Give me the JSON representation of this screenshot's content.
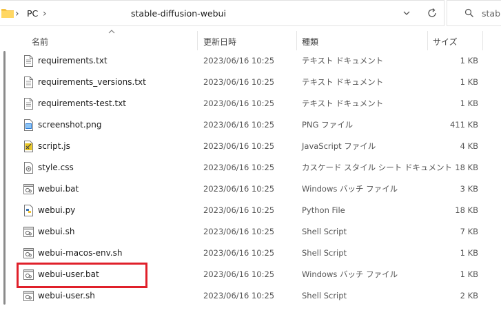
{
  "address_bar": {
    "crumbs": [
      "PC",
      "stable-diffusion-webui"
    ]
  },
  "search": {
    "text": "stable"
  },
  "columns": {
    "name": "名前",
    "date": "更新日時",
    "type": "種類",
    "size": "サイズ"
  },
  "files": [
    {
      "name": "requirements.txt",
      "date": "2023/06/16 10:25",
      "type": "テキスト ドキュメント",
      "size": "1 KB",
      "icon": "text-file-icon"
    },
    {
      "name": "requirements_versions.txt",
      "date": "2023/06/16 10:25",
      "type": "テキスト ドキュメント",
      "size": "1 KB",
      "icon": "text-file-icon"
    },
    {
      "name": "requirements-test.txt",
      "date": "2023/06/16 10:25",
      "type": "テキスト ドキュメント",
      "size": "1 KB",
      "icon": "text-file-icon"
    },
    {
      "name": "screenshot.png",
      "date": "2023/06/16 10:25",
      "type": "PNG ファイル",
      "size": "411 KB",
      "icon": "image-file-icon"
    },
    {
      "name": "script.js",
      "date": "2023/06/16 10:25",
      "type": "JavaScript ファイル",
      "size": "4 KB",
      "icon": "script-file-icon"
    },
    {
      "name": "style.css",
      "date": "2023/06/16 10:25",
      "type": "カスケード スタイル シート ドキュメント",
      "size": "18 KB",
      "icon": "css-file-icon"
    },
    {
      "name": "webui.bat",
      "date": "2023/06/16 10:25",
      "type": "Windows バッチ ファイル",
      "size": "3 KB",
      "icon": "batch-file-icon"
    },
    {
      "name": "webui.py",
      "date": "2023/06/16 10:25",
      "type": "Python File",
      "size": "18 KB",
      "icon": "python-file-icon"
    },
    {
      "name": "webui.sh",
      "date": "2023/06/16 10:25",
      "type": "Shell Script",
      "size": "7 KB",
      "icon": "shell-file-icon"
    },
    {
      "name": "webui-macos-env.sh",
      "date": "2023/06/16 10:25",
      "type": "Shell Script",
      "size": "1 KB",
      "icon": "shell-file-icon"
    },
    {
      "name": "webui-user.bat",
      "date": "2023/06/16 10:25",
      "type": "Windows バッチ ファイル",
      "size": "1 KB",
      "icon": "batch-file-icon"
    },
    {
      "name": "webui-user.sh",
      "date": "2023/06/16 10:25",
      "type": "Shell Script",
      "size": "2 KB",
      "icon": "shell-file-icon"
    }
  ],
  "colors": {
    "highlight": "#e0202a",
    "folder": "#f5c242"
  }
}
